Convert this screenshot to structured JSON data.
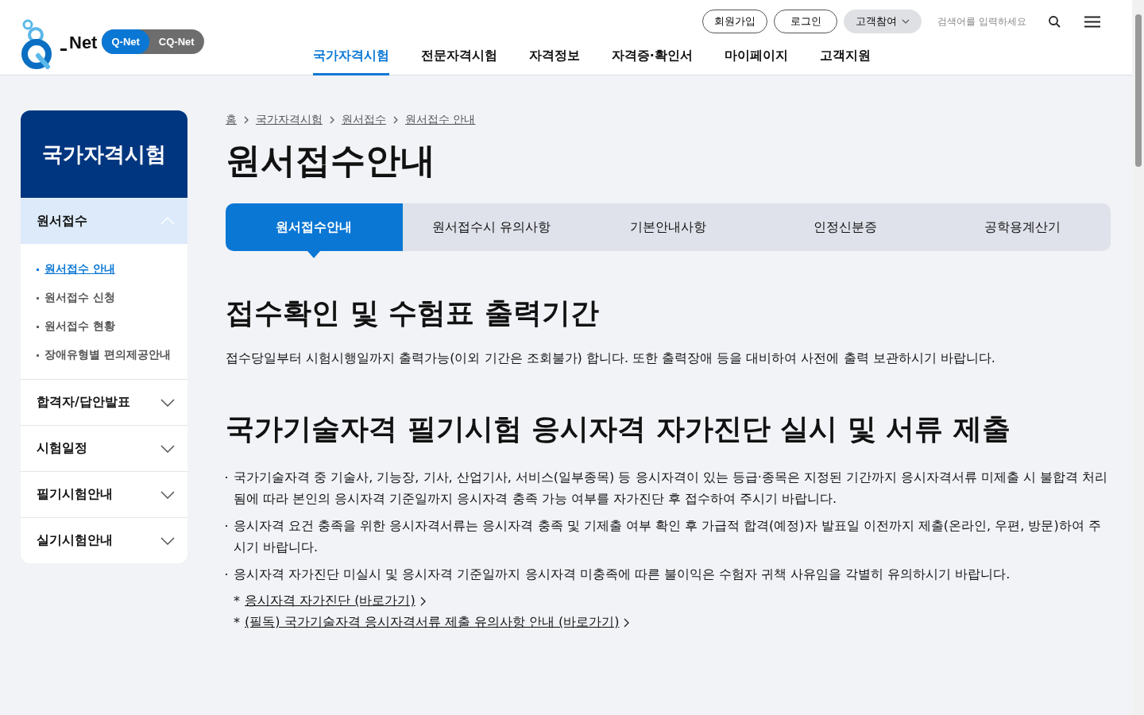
{
  "header": {
    "logo_text": "Net",
    "brand_switch": [
      {
        "label": "Q-Net",
        "selected": true
      },
      {
        "label": "CQ-Net",
        "selected": false
      }
    ],
    "nav": [
      {
        "label": "국가자격시험",
        "selected": true
      },
      {
        "label": "전문자격시험",
        "selected": false
      },
      {
        "label": "자격정보",
        "selected": false
      },
      {
        "label": "자격증·확인서",
        "selected": false
      },
      {
        "label": "마이페이지",
        "selected": false
      },
      {
        "label": "고객지원",
        "selected": false
      }
    ],
    "util_buttons": [
      "회원가입",
      "로그인"
    ],
    "customer_menu": "고객참여",
    "search": {
      "placeholder": "검색어를 입력하세요"
    }
  },
  "sidebar": {
    "title": "국가자격시험",
    "sections": [
      {
        "label": "원서접수",
        "expanded": true,
        "children": [
          {
            "label": "원서접수 안내",
            "selected": true
          },
          {
            "label": "원서접수 신청",
            "selected": false
          },
          {
            "label": "원서접수 현황",
            "selected": false
          },
          {
            "label": "장애유형별 편의제공안내",
            "selected": false
          }
        ]
      },
      {
        "label": "합격자/답안발표",
        "expanded": false
      },
      {
        "label": "시험일정",
        "expanded": false
      },
      {
        "label": "필기시험안내",
        "expanded": false
      },
      {
        "label": "실기시험안내",
        "expanded": false
      }
    ]
  },
  "breadcrumb": [
    "홈",
    "국가자격시험",
    "원서접수",
    "원서접수 안내"
  ],
  "page_title": "원서접수안내",
  "tabs": [
    {
      "label": "원서접수안내",
      "selected": true
    },
    {
      "label": "원서접수시 유의사항",
      "selected": false
    },
    {
      "label": "기본안내사항",
      "selected": false
    },
    {
      "label": "인정신분증",
      "selected": false
    },
    {
      "label": "공학용계산기",
      "selected": false
    }
  ],
  "sections": [
    {
      "heading": "접수확인 및 수험표 출력기간",
      "paragraph": "접수당일부터 시험시행일까지 출력가능(이외 기간은 조회불가) 합니다. 또한 출력장애 등을 대비하여 사전에 출력 보관하시기 바랍니다."
    },
    {
      "heading": "국가기술자격 필기시험 응시자격 자가진단 실시 및 서류 제출",
      "bullets": [
        "국가기술자격 중 기술사, 기능장, 기사, 산업기사, 서비스(일부종목) 등 응시자격이 있는 등급·종목은 지정된 기간까지 응시자격서류 미제출 시 불합격 처리 됨에 따라 본인의 응시자격 기준일까지 응시자격 충족 가능 여부를 자가진단 후 접수하여 주시기 바랍니다.",
        "응시자격 요건 충족을 위한 응시자격서류는 응시자격 충족 및 기제출 여부 확인 후 가급적 합격(예정)자 발표일 이전까지 제출(온라인, 우편, 방문)하여 주시기 바랍니다.",
        "응시자격 자가진단 미실시 및 응시자격 기준일까지 응시자격 미충족에 따른 불이익은 수험자 귀책 사유임을 각별히 유의하시기 바랍니다."
      ],
      "links": [
        {
          "marker": "*",
          "label": "응시자격 자가진단 (바로가기)"
        },
        {
          "marker": "*",
          "label": "(필독) 국가기술자격 응시자격서류 제출 유의사항 안내 (바로가기)"
        }
      ]
    }
  ]
}
